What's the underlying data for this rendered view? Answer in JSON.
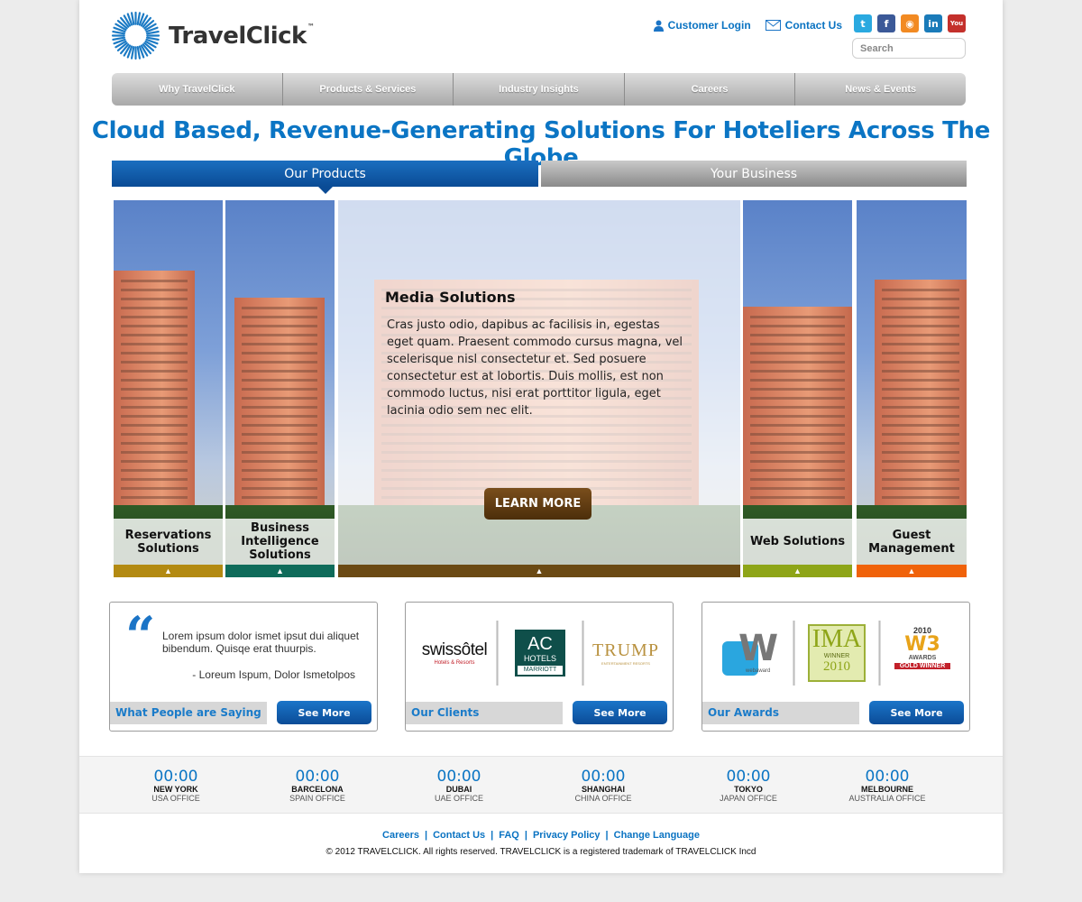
{
  "brand": {
    "name": "TravelClick",
    "tm": "™",
    "accent": "#0b75c4"
  },
  "header": {
    "customer_login": "Customer Login",
    "contact_us": "Contact Us",
    "search_placeholder": "Search",
    "social": [
      {
        "icon": "twitter-icon",
        "glyph": "t",
        "color": "#2aa9e0"
      },
      {
        "icon": "facebook-icon",
        "glyph": "f",
        "color": "#3b5998"
      },
      {
        "icon": "rss-icon",
        "glyph": "◉",
        "color": "#f28a22"
      },
      {
        "icon": "linkedin-icon",
        "glyph": "in",
        "color": "#1a7bb9"
      },
      {
        "icon": "youtube-icon",
        "glyph": "You\nTube",
        "color": "#c4302b"
      }
    ]
  },
  "nav": {
    "items": [
      "Why TravelClick",
      "Products & Services",
      "Industry Insights",
      "Careers",
      "News & Events"
    ]
  },
  "headline": "Cloud Based, Revenue-Generating Solutions For Hoteliers Across The Globe",
  "tabs": {
    "products": "Our Products",
    "business": "Your Business"
  },
  "hero": {
    "panels": [
      {
        "label": "Reservations Solutions",
        "color": "#b38a12"
      },
      {
        "label": "Business Intelligence Solutions",
        "color": "#0f6b5a"
      },
      {
        "label": "Web Solutions",
        "color": "#8ea518"
      },
      {
        "label": "Guest Management",
        "color": "#f0620a"
      }
    ],
    "featured": {
      "title": "Media Solutions",
      "description": "Cras justo odio, dapibus ac facilisis in, egestas eget quam. Praesent commodo cursus magna, vel scelerisque nisl consectetur et. Sed posuere consectetur est at lobortis. Duis mollis, est non commodo luctus, nisi erat porttitor ligula, eget lacinia odio sem nec elit.",
      "button": "LEARN MORE",
      "color": "#6b4a14"
    }
  },
  "testimonial": {
    "quote_mark": "“",
    "text": "Lorem ipsum dolor ismet ipsut dui aliquet bibendum. Quisqe erat thuurpis.",
    "author": "- Loreum Ispum, Dolor Ismetolpos",
    "label": "What People are Saying",
    "button": "See More"
  },
  "clients": {
    "label": "Our Clients",
    "button": "See More",
    "logos": {
      "swissotel_main": "swissôtel",
      "swissotel_sub": "Hotels & Resorts",
      "ac_main": "AC",
      "ac_sub": "HOTELS",
      "ac_brand": "MARRIOTT",
      "trump_main": "TRUMP",
      "trump_sub": "ENTERTAINMENT RESORTS"
    }
  },
  "awards": {
    "label": "Our Awards",
    "button": "See More",
    "logos": {
      "webaward_letter": "W",
      "webaward_text": "webaward",
      "ima_main": "IMA",
      "ima_sub": "WINNER",
      "ima_year": "2010",
      "w3_year": "2010",
      "w3_mark": "W3",
      "w3_sub": "AWARDS",
      "w3_banner": "GOLD WINNER"
    }
  },
  "clocks": [
    {
      "time": "00:00",
      "city": "NEW YORK",
      "office": "USA OFFICE"
    },
    {
      "time": "00:00",
      "city": "BARCELONA",
      "office": "SPAIN OFFICE"
    },
    {
      "time": "00:00",
      "city": "DUBAI",
      "office": "UAE OFFICE"
    },
    {
      "time": "00:00",
      "city": "SHANGHAI",
      "office": "CHINA OFFICE"
    },
    {
      "time": "00:00",
      "city": "TOKYO",
      "office": "JAPAN OFFICE"
    },
    {
      "time": "00:00",
      "city": "MELBOURNE",
      "office": "AUSTRALIA OFFICE"
    }
  ],
  "footer": {
    "links": [
      "Careers",
      "Contact Us",
      "FAQ",
      "Privacy Policy",
      "Change Language"
    ],
    "separator": "|",
    "copyright": "© 2012 TRAVELCLICK. All rights reserved. TRAVELCLICK is a registered trademark of TRAVELCLICK Incd"
  }
}
